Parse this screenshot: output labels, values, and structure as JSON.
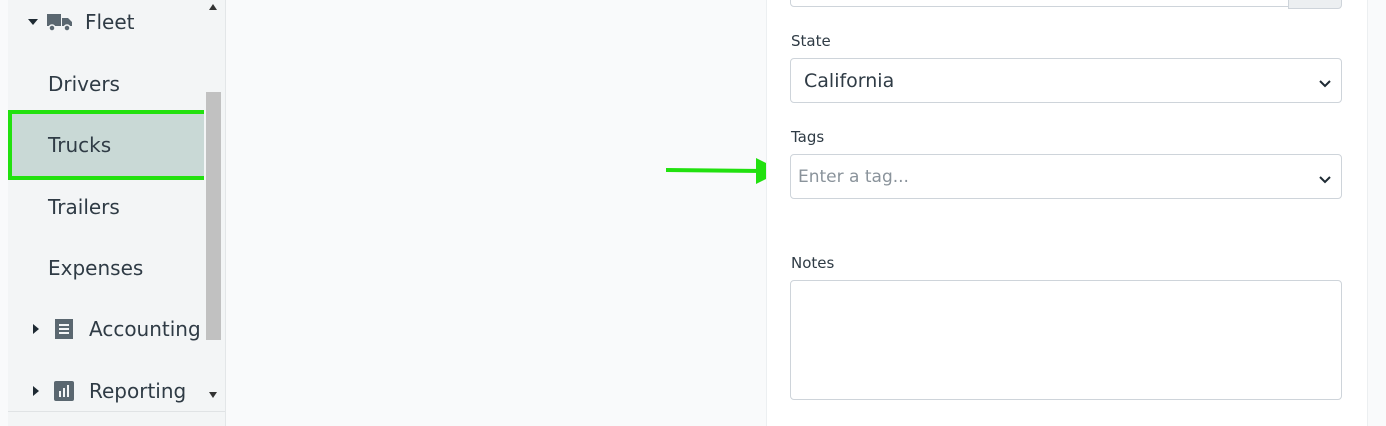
{
  "sidebar": {
    "fleet": {
      "label": "Fleet",
      "icon": "truck-icon"
    },
    "items": [
      {
        "label": "Drivers"
      },
      {
        "label": "Trucks",
        "active": true
      },
      {
        "label": "Trailers"
      },
      {
        "label": "Expenses"
      }
    ],
    "accounting": {
      "label": "Accounting",
      "icon": "ledger-icon"
    },
    "reporting": {
      "label": "Reporting",
      "icon": "chart-icon"
    }
  },
  "form": {
    "state_label": "State",
    "state_value": "California",
    "tags_label": "Tags",
    "tags_placeholder": "Enter a tag...",
    "notes_label": "Notes",
    "notes_value": ""
  },
  "colors": {
    "highlight": "#22e10f",
    "active_bg": "#c9d9d6"
  }
}
